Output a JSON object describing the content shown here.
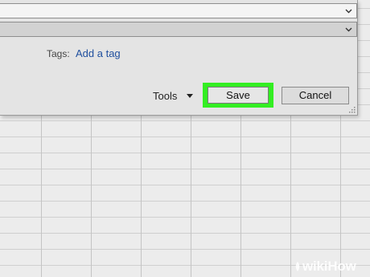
{
  "dialog": {
    "tags_label": "Tags:",
    "add_tag_link": "Add a tag",
    "tools_label": "Tools",
    "save_label": "Save",
    "cancel_label": "Cancel"
  },
  "colors": {
    "highlight": "#33ee22",
    "link": "#1f4f9e"
  },
  "icons": [
    "chevron-down-icon",
    "caret-down-icon",
    "resize-grip-icon"
  ],
  "watermark": {
    "text": "wikiHow"
  }
}
